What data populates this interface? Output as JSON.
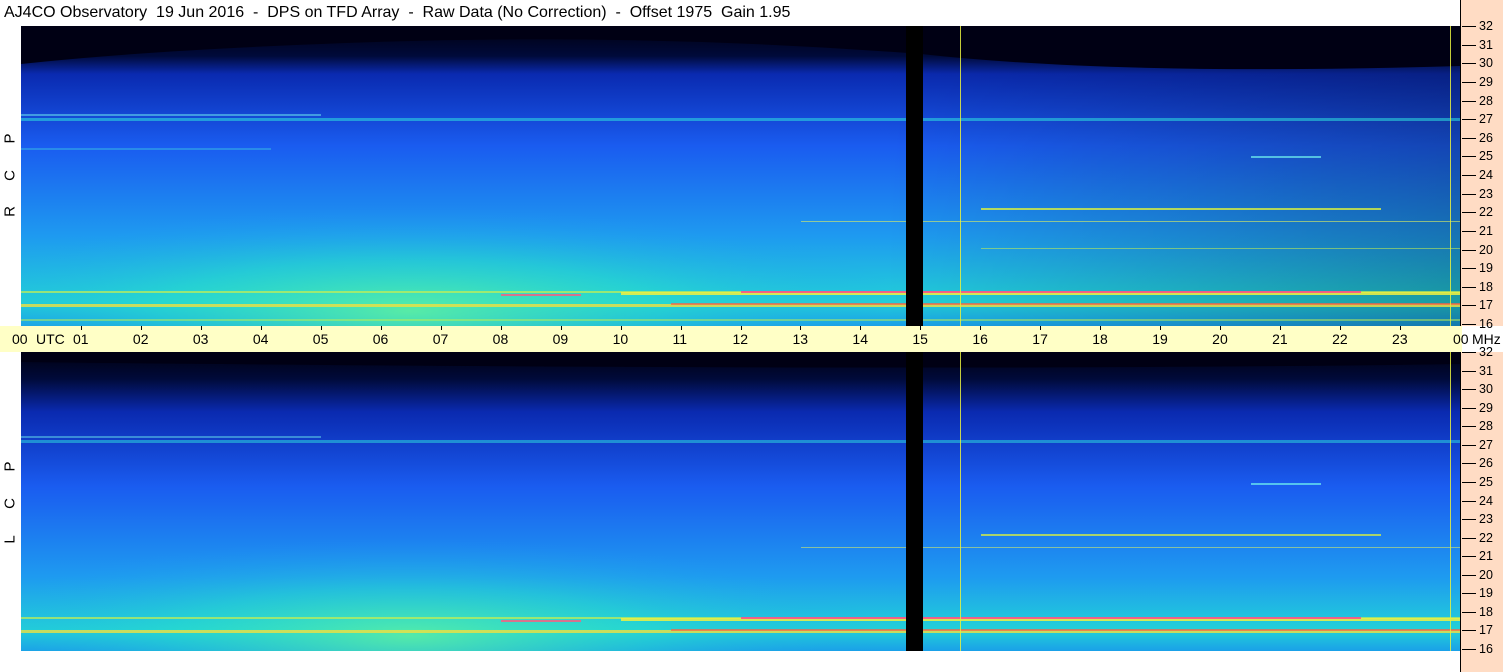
{
  "title": "AJ4CO Observatory  19 Jun 2016  -  DPS on TFD Array  -  Raw Data (No Correction)  -  Offset 1975  Gain 1.95",
  "panels": {
    "top": {
      "polarization_letters": [
        "R",
        "C",
        "P"
      ]
    },
    "bottom": {
      "polarization_letters": [
        "L",
        "C",
        "P"
      ]
    }
  },
  "time_axis": {
    "start_label": "00",
    "utc_label": "UTC",
    "hour_labels": [
      "01",
      "02",
      "03",
      "04",
      "05",
      "06",
      "07",
      "08",
      "09",
      "10",
      "11",
      "12",
      "13",
      "14",
      "15",
      "16",
      "17",
      "18",
      "19",
      "20",
      "21",
      "22",
      "23"
    ],
    "end_label": "00",
    "unit_label": "MHz"
  },
  "freq_axis": {
    "labels": [
      "32",
      "31",
      "30",
      "29",
      "28",
      "27",
      "26",
      "25",
      "24",
      "23",
      "22",
      "21",
      "20",
      "19",
      "18",
      "17",
      "16"
    ],
    "min_mhz": 16,
    "max_mhz": 32
  },
  "data_gap_hours": [
    14.75,
    15.05
  ],
  "marker_lines_hours": [
    15.65,
    23.9
  ],
  "colors": {
    "axis_time_bg": "#ffffc6",
    "axis_freq_bg": "#ffdcc4",
    "spectrogram_dark": "#000014",
    "spectrogram_blue": "#1e5ff0",
    "spectrogram_cyan": "#19d2d2",
    "spectrogram_green": "#46e6a0"
  }
}
